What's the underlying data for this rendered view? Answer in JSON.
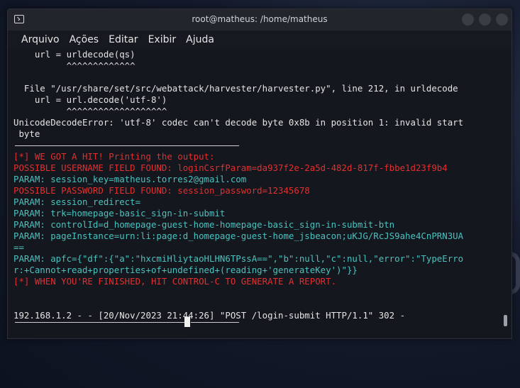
{
  "window": {
    "title": "root@matheus: /home/matheus"
  },
  "menu": {
    "items": [
      "Arquivo",
      "Ações",
      "Editar",
      "Exibir",
      "Ajuda"
    ]
  },
  "terminal": {
    "lines": [
      {
        "text": "    url = urldecode(qs)",
        "color": "w"
      },
      {
        "text": "          ^^^^^^^^^^^^^",
        "color": "w"
      },
      {
        "text": "",
        "color": "w"
      },
      {
        "text": "  File \"/usr/share/set/src/webattack/harvester/harvester.py\", line 212, in urldecode",
        "color": "w"
      },
      {
        "text": "    url = url.decode('utf-8')",
        "color": "w"
      },
      {
        "text": "          ^^^^^^^^^^^^^^^^^^^",
        "color": "w"
      },
      {
        "text": "UnicodeDecodeError: 'utf-8' codec can't decode byte 0x8b in position 1: invalid start",
        "color": "w"
      },
      {
        "text": " byte",
        "color": "w"
      },
      {
        "text": "",
        "color": "rule"
      },
      {
        "text": "[*] WE GOT A HIT! Printing the output:",
        "color": "r"
      },
      {
        "text": "POSSIBLE USERNAME FIELD FOUND: loginCsrfParam=da937f2e-2a5d-482d-817f-fbbe1d23f9b4",
        "color": "r"
      },
      {
        "text": "PARAM: session_key=matheus.torres2@gmail.com",
        "color": "c"
      },
      {
        "text": "POSSIBLE PASSWORD FIELD FOUND: session_password=12345678",
        "color": "r"
      },
      {
        "text": "PARAM: session_redirect=",
        "color": "c"
      },
      {
        "text": "PARAM: trk=homepage-basic_sign-in-submit",
        "color": "c"
      },
      {
        "text": "PARAM: controlId=d_homepage-guest-home-homepage-basic_sign-in-submit-btn",
        "color": "c"
      },
      {
        "text": "PARAM: pageInstance=urn:li:page:d_homepage-guest-home_jsbeacon;uKJG/RcJS9ahe4CnPRN3UA",
        "color": "c"
      },
      {
        "text": "==",
        "color": "c"
      },
      {
        "text": "PARAM: apfc={\"df\":{\"a\":\"hxcmiHliytaoHLHN6TPssA==\",\"b\":null,\"c\":null,\"error\":\"TypeErro",
        "color": "c"
      },
      {
        "text": "r:+Cannot+read+properties+of+undefined+(reading+'generateKey')\"}}",
        "color": "c"
      },
      {
        "text": "[*] WHEN YOU'RE FINISHED, HIT CONTROL-C TO GENERATE A REPORT.",
        "color": "r"
      },
      {
        "text": "",
        "color": "w"
      },
      {
        "text": "",
        "color": "w"
      },
      {
        "text": "192.168.1.2 - - [20/Nov/2023 21:44:26] \"POST /login-submit HTTP/1.1\" 302 -",
        "color": "w"
      }
    ]
  }
}
